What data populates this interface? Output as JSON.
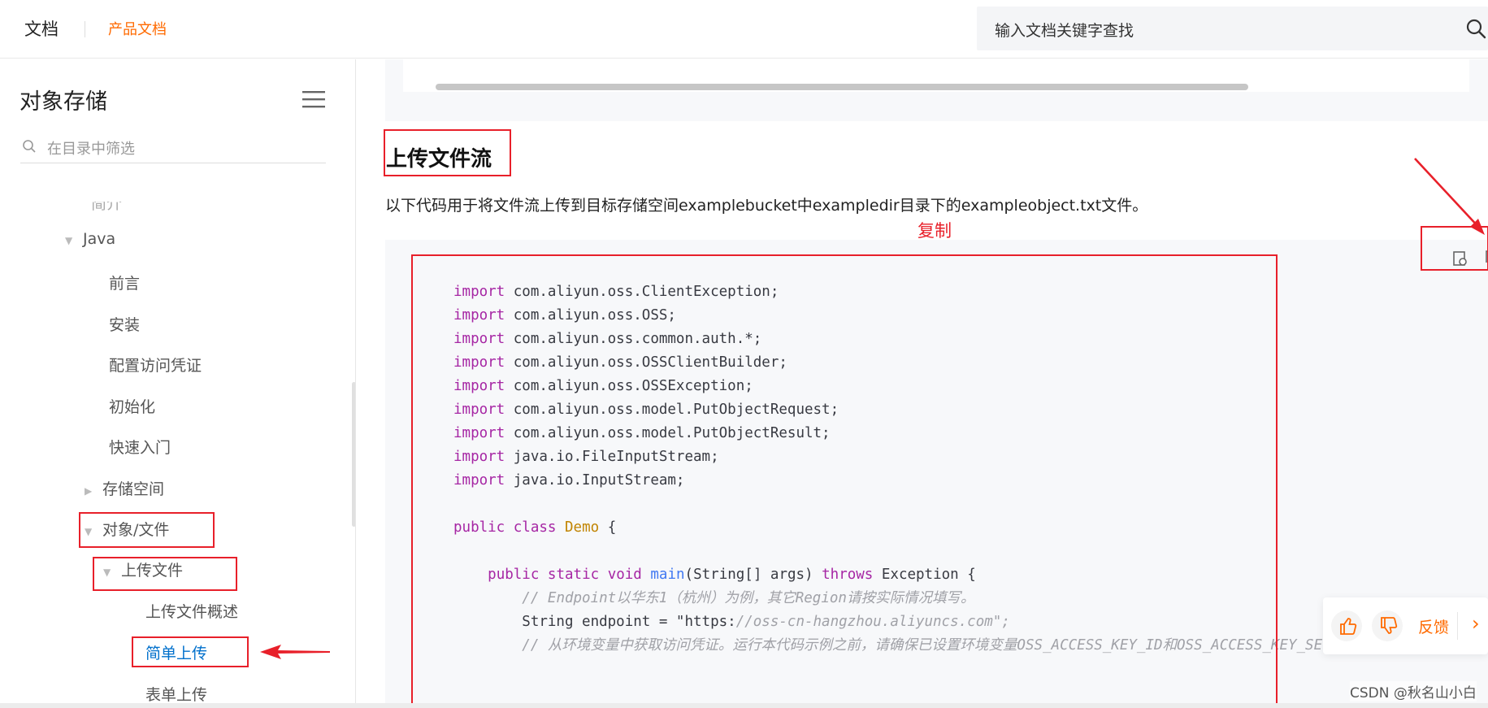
{
  "header": {
    "brand": "文档",
    "product": "产品文档",
    "search_placeholder": "输入文档关键字查找"
  },
  "sidebar": {
    "title": "对象存储",
    "filter_placeholder": "在目录中筛选",
    "items": [
      {
        "label": "简介",
        "level": 2
      },
      {
        "label": "Java",
        "level": 1,
        "caret": "▼"
      },
      {
        "label": "前言",
        "level": 2
      },
      {
        "label": "安装",
        "level": 2
      },
      {
        "label": "配置访问凭证",
        "level": 2
      },
      {
        "label": "初始化",
        "level": 2
      },
      {
        "label": "快速入门",
        "level": 2
      },
      {
        "label": "存储空间",
        "level": 2,
        "caret": "▶"
      },
      {
        "label": "对象/文件",
        "level": 2,
        "caret": "▼"
      },
      {
        "label": "上传文件",
        "level": 3,
        "caret": "▼"
      },
      {
        "label": "上传文件概述",
        "level": 4
      },
      {
        "label": "简单上传",
        "level": 4,
        "active": true
      },
      {
        "label": "表单上传",
        "level": 4
      }
    ]
  },
  "content": {
    "heading": "上传文件流",
    "description": "以下代码用于将文件流上传到目标存储空间examplebucket中exampledir目录下的exampleobject.txt文件。",
    "annotation_copy": "复制",
    "code_lines": [
      "import com.aliyun.oss.ClientException;",
      "import com.aliyun.oss.OSS;",
      "import com.aliyun.oss.common.auth.*;",
      "import com.aliyun.oss.OSSClientBuilder;",
      "import com.aliyun.oss.OSSException;",
      "import com.aliyun.oss.model.PutObjectRequest;",
      "import com.aliyun.oss.model.PutObjectResult;",
      "import java.io.FileInputStream;",
      "import java.io.InputStream;",
      "",
      "public class Demo {",
      "",
      "    public static void main(String[] args) throws Exception {",
      "        // Endpoint以华东1（杭州）为例，其它Region请按实际情况填写。",
      "        String endpoint = \"https://oss-cn-hangzhou.aliyuncs.com\";",
      "        // 从环境变量中获取访问凭证。运行本代码示例之前，请确保已设置环境变量OSS_ACCESS_KEY_ID和OSS_ACCESS_KEY_SECRET。"
    ]
  },
  "feedback": {
    "label": "反馈"
  },
  "watermark": "CSDN @秋名山小白",
  "colors": {
    "accent": "#ff6a00",
    "annotation_red": "#e8202a",
    "active_link": "#0070cc"
  }
}
